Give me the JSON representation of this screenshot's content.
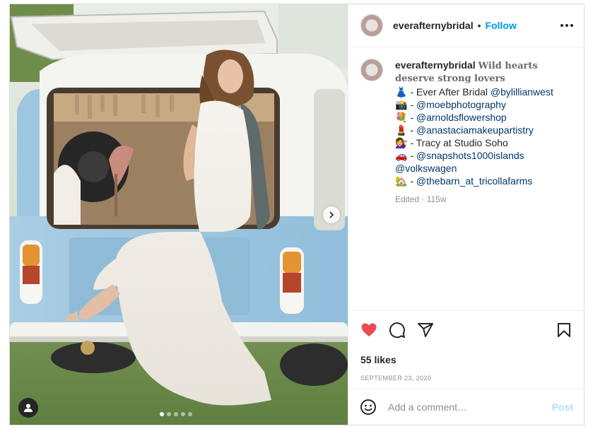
{
  "account": {
    "username": "everafternybridal",
    "separator": "•",
    "follow_label": "Follow"
  },
  "caption": {
    "username": "everafternybridal",
    "headline_1": "Wild hearts",
    "headline_2": "deserve strong lovers",
    "lines": [
      {
        "emoji": "👗",
        "text": " - Ever After Bridal ",
        "mention": "@bylillianwest"
      },
      {
        "emoji": "📸",
        "text": " - ",
        "mention": "@moebphotography"
      },
      {
        "emoji": "💐",
        "text": " - ",
        "mention": "@arnoldsflowershop"
      },
      {
        "emoji": "💄",
        "text": " - ",
        "mention": "@anastaciamakeupartistry"
      },
      {
        "emoji": "💇‍♀️",
        "text": " - Tracy at Studio Soho",
        "mention": ""
      },
      {
        "emoji": "🚗",
        "text": " - ",
        "mention": "@snapshots1000islands"
      },
      {
        "emoji": "",
        "text": "",
        "mention": "@volkswagen"
      },
      {
        "emoji": "🏡",
        "text": " - ",
        "mention": "@thebarn_at_tricollafarms"
      }
    ],
    "edited": "Edited",
    "dot": "·",
    "age": "115w"
  },
  "engagement": {
    "likes": "55 likes",
    "date": "SEPTEMBER 23, 2020"
  },
  "comment": {
    "placeholder": "Add a comment…",
    "post_label": "Post"
  },
  "icons": {
    "like": "heart-filled-icon",
    "comment": "comment-icon",
    "share": "paper-plane-icon",
    "save": "bookmark-icon",
    "emoji": "smiley-icon",
    "more": "more-horizontal-icon",
    "next": "chevron-right-icon",
    "tag": "user-tag-icon"
  },
  "colors": {
    "like": "#ed4956",
    "link": "#00376b",
    "follow": "#0095f6",
    "post_disabled": "#b2dffc",
    "muted": "#8e8e8e"
  },
  "carousel": {
    "slide_count": 5,
    "active_index": 0
  }
}
